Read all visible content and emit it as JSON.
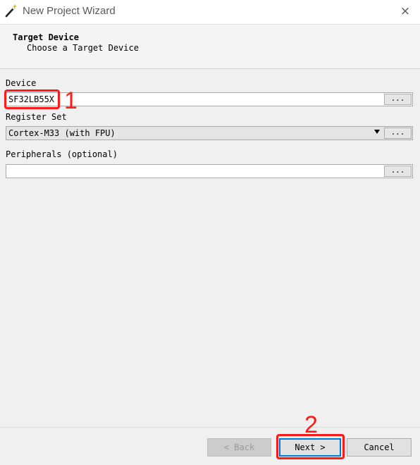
{
  "window": {
    "title": "New Project Wizard",
    "close_icon": "×"
  },
  "header": {
    "title": "Target Device",
    "subtitle": "Choose a Target Device"
  },
  "device": {
    "label": "Device",
    "value": "SF32LB55X",
    "browse_label": "..."
  },
  "register_set": {
    "label": "Register Set",
    "selected": "Cortex-M33 (with FPU)",
    "browse_label": "..."
  },
  "peripherals": {
    "label": "Peripherals (optional)",
    "value": "",
    "browse_label": "..."
  },
  "annotations": {
    "step1": "1",
    "step2": "2",
    "color": "#ff1a1a"
  },
  "footer": {
    "back_label": "< Back",
    "next_label": "Next >",
    "cancel_label": "Cancel"
  },
  "colors": {
    "accent": "#0078d7",
    "background": "#f0f0f0"
  }
}
